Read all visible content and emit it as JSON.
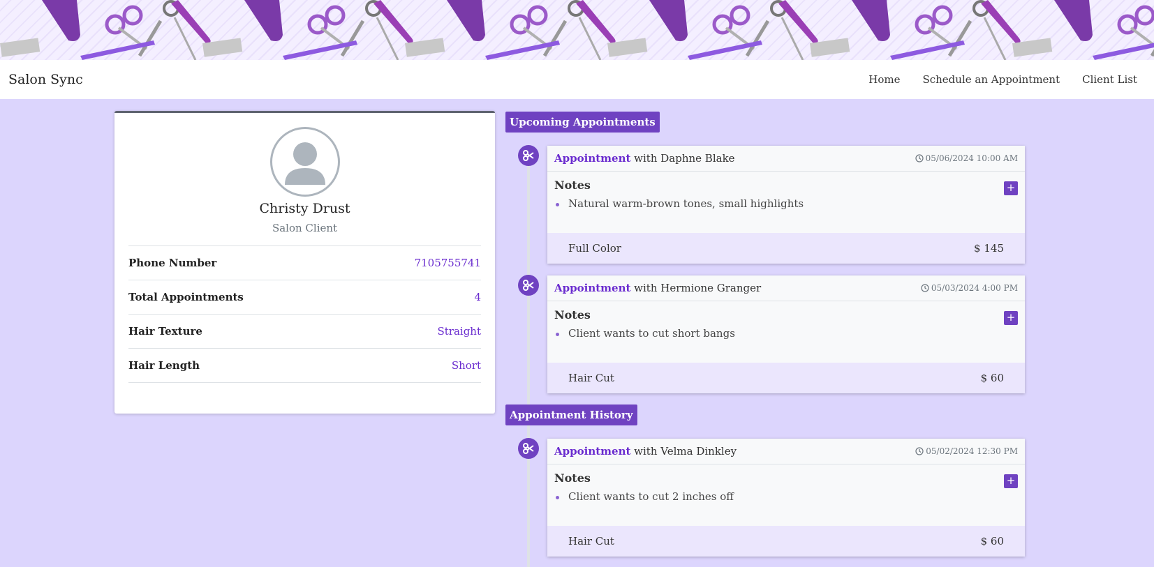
{
  "app": {
    "brand": "Salon Sync",
    "nav": [
      "Home",
      "Schedule an Appointment",
      "Client List"
    ]
  },
  "profile": {
    "name": "Christy Drust",
    "role": "Salon Client",
    "fields": [
      {
        "label": "Phone Number",
        "value": "7105755741"
      },
      {
        "label": "Total Appointments",
        "value": "4"
      },
      {
        "label": "Hair Texture",
        "value": "Straight"
      },
      {
        "label": "Hair Length",
        "value": "Short"
      }
    ]
  },
  "sections": {
    "upcoming": "Upcoming Appointments",
    "history": "Appointment History"
  },
  "appointments": [
    {
      "keyword": "Appointment",
      "with_text": " with Daphne Blake",
      "datetime": "05/06/2024 10:00 AM",
      "notes_title": "Notes",
      "note": "Natural warm-brown tones, small highlights",
      "service": "Full Color",
      "price": "$ 145"
    },
    {
      "keyword": "Appointment",
      "with_text": " with Hermione Granger",
      "datetime": "05/03/2024 4:00 PM",
      "notes_title": "Notes",
      "note": "Client wants to cut short bangs",
      "service": "Hair Cut",
      "price": "$ 60"
    },
    {
      "keyword": "Appointment",
      "with_text": " with Velma Dinkley",
      "datetime": "05/02/2024 12:30 PM",
      "notes_title": "Notes",
      "note": "Client wants to cut 2 inches off",
      "service": "Hair Cut",
      "price": "$ 60"
    }
  ],
  "icons": {
    "timeline": "scissors-icon",
    "time": "clock-icon",
    "add": "plus-icon",
    "avatar": "user-avatar-icon"
  },
  "colors": {
    "accent": "#6f42c1",
    "page_bg": "#dcd5fd",
    "link": "#6a2ccf"
  }
}
